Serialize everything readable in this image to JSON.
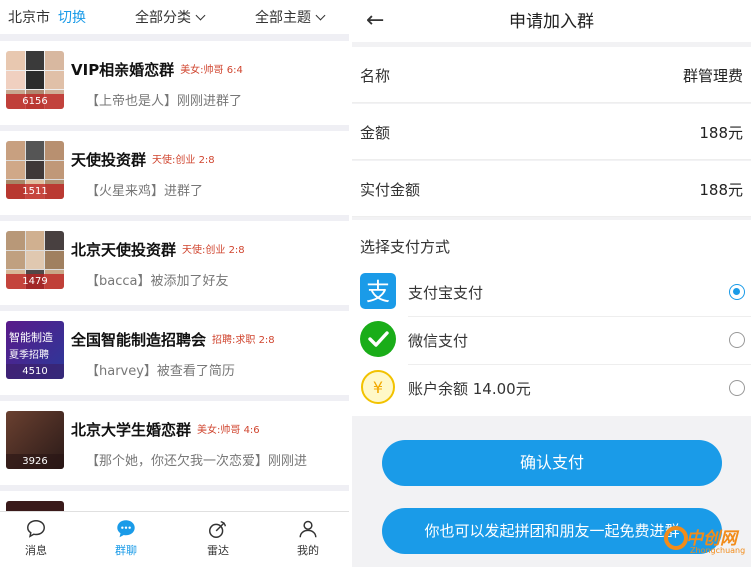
{
  "left": {
    "filter": {
      "city": "北京市",
      "switch": "切换",
      "category": "全部分类",
      "theme": "全部主题"
    },
    "groups": [
      {
        "title": "VIP相亲婚恋群",
        "tag": "美女:帅哥 6:4",
        "message": "【上帝也是人】刚刚进群了",
        "count": "6156"
      },
      {
        "title": "天使投资群",
        "tag": "天使:创业 2:8",
        "message": "【火星来鸡】进群了",
        "count": "1511"
      },
      {
        "title": "北京天使投资群",
        "tag": "天使:创业 2:8",
        "message": "【bacca】被添加了好友",
        "count": "1479"
      },
      {
        "title": "全国智能制造招聘会",
        "tag": "招聘:求职 2:8",
        "message": "【harvey】被查看了简历",
        "count": "4510",
        "cover_text": "智能制造",
        "cover_sub": "夏季招聘"
      },
      {
        "title": "北京大学生婚恋群",
        "tag": "美女:帅哥 4:6",
        "message": "【那个她，你还欠我一次恋爱】刚刚进",
        "count": "3926"
      }
    ],
    "tabs": [
      {
        "label": "消息",
        "icon": "chat-bubble-icon"
      },
      {
        "label": "群聊",
        "icon": "group-chat-icon",
        "active": true
      },
      {
        "label": "雷达",
        "icon": "radar-icon"
      },
      {
        "label": "我的",
        "icon": "person-icon"
      }
    ]
  },
  "right": {
    "header": {
      "title": "申请加入群",
      "back_icon": "back-arrow-icon"
    },
    "rows": [
      {
        "label": "名称",
        "value": "群管理费"
      },
      {
        "label": "金额",
        "value": "188元"
      },
      {
        "label": "实付金额",
        "value": "188元"
      }
    ],
    "pay": {
      "title": "选择支付方式",
      "options": [
        {
          "label": "支付宝支付",
          "icon": "alipay-icon",
          "selected": true
        },
        {
          "label": "微信支付",
          "icon": "wechat-pay-icon",
          "selected": false
        },
        {
          "label": "账户余额 14.00元",
          "icon": "balance-icon",
          "selected": false
        }
      ]
    },
    "confirm_button": "确认支付",
    "group_button": "你也可以发起拼团和朋友一起免费进群",
    "watermark": {
      "logo": "中创网",
      "sub": "Zhongchuang"
    }
  },
  "colors": {
    "accent": "#1a9be8",
    "tag": "#d0452f",
    "count_badge": "#be1e1e",
    "alipay": "#1a9be8",
    "wechat": "#1aad19",
    "balance": "#f2c200",
    "watermark": "#f28c1a"
  }
}
